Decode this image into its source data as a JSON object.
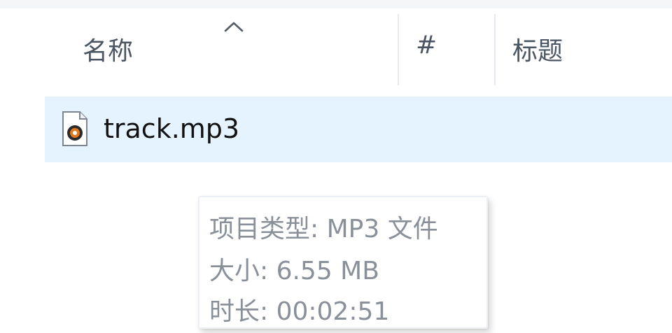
{
  "columns": {
    "name": "名称",
    "number": "#",
    "title": "标题"
  },
  "sort": {
    "icon": "chevron-up-icon",
    "direction": "ascending"
  },
  "files": [
    {
      "name": "track.mp3",
      "icon": "mp3-file-icon"
    }
  ],
  "tooltip": {
    "type": "项目类型: MP3 文件",
    "size": "大小: 6.55 MB",
    "duration": "时长: 00:02:51"
  },
  "colors": {
    "selection": "#e5f3ff",
    "header_text": "#4a5563",
    "tooltip_text": "#8a909a",
    "divider": "#e6e9ee"
  }
}
